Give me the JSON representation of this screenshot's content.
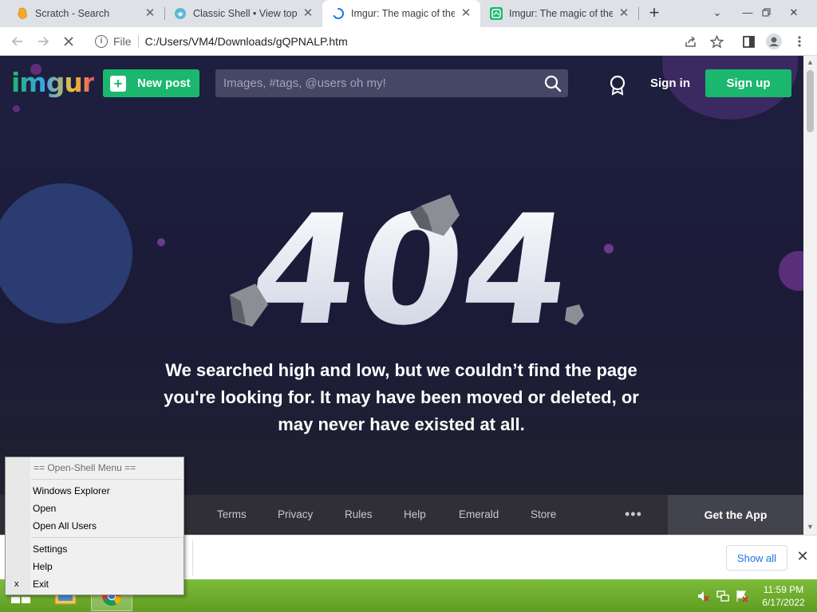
{
  "browser": {
    "tabs": [
      {
        "title": "Scratch - Search",
        "active": false
      },
      {
        "title": "Classic Shell • View topic",
        "active": false
      },
      {
        "title": "Imgur: The magic of the",
        "active": true
      },
      {
        "title": "Imgur: The magic of the",
        "active": false
      }
    ],
    "url_scheme": "File",
    "url": "C:/Users/VM4/Downloads/gQPNALP.htm"
  },
  "imgur": {
    "logo": "imgur",
    "new_post": "New post",
    "search_placeholder": "Images, #tags, @users oh my!",
    "sign_in": "Sign in",
    "sign_up": "Sign up",
    "error_code": "404",
    "message": "We searched high and low, but we couldn’t find the page you're looking for. It may have been moved or deleted, or may never have existed at all.",
    "footer_links": [
      "Terms",
      "Privacy",
      "Rules",
      "Help",
      "Emerald",
      "Store"
    ],
    "footer_more": "•••",
    "get_app": "Get the App",
    "colors": {
      "green": "#1bb76e",
      "background": "#1e1e3f",
      "search_bg": "#464665"
    }
  },
  "download_shelf": {
    "show_all": "Show all"
  },
  "context_menu": {
    "header": "== Open-Shell Menu ==",
    "items": [
      "Windows Explorer",
      "Open",
      "Open All Users",
      "Settings",
      "Help",
      "Exit"
    ],
    "exit_mark": "x"
  },
  "taskbar": {
    "time": "11:59 PM",
    "date": "6/17/2022"
  }
}
